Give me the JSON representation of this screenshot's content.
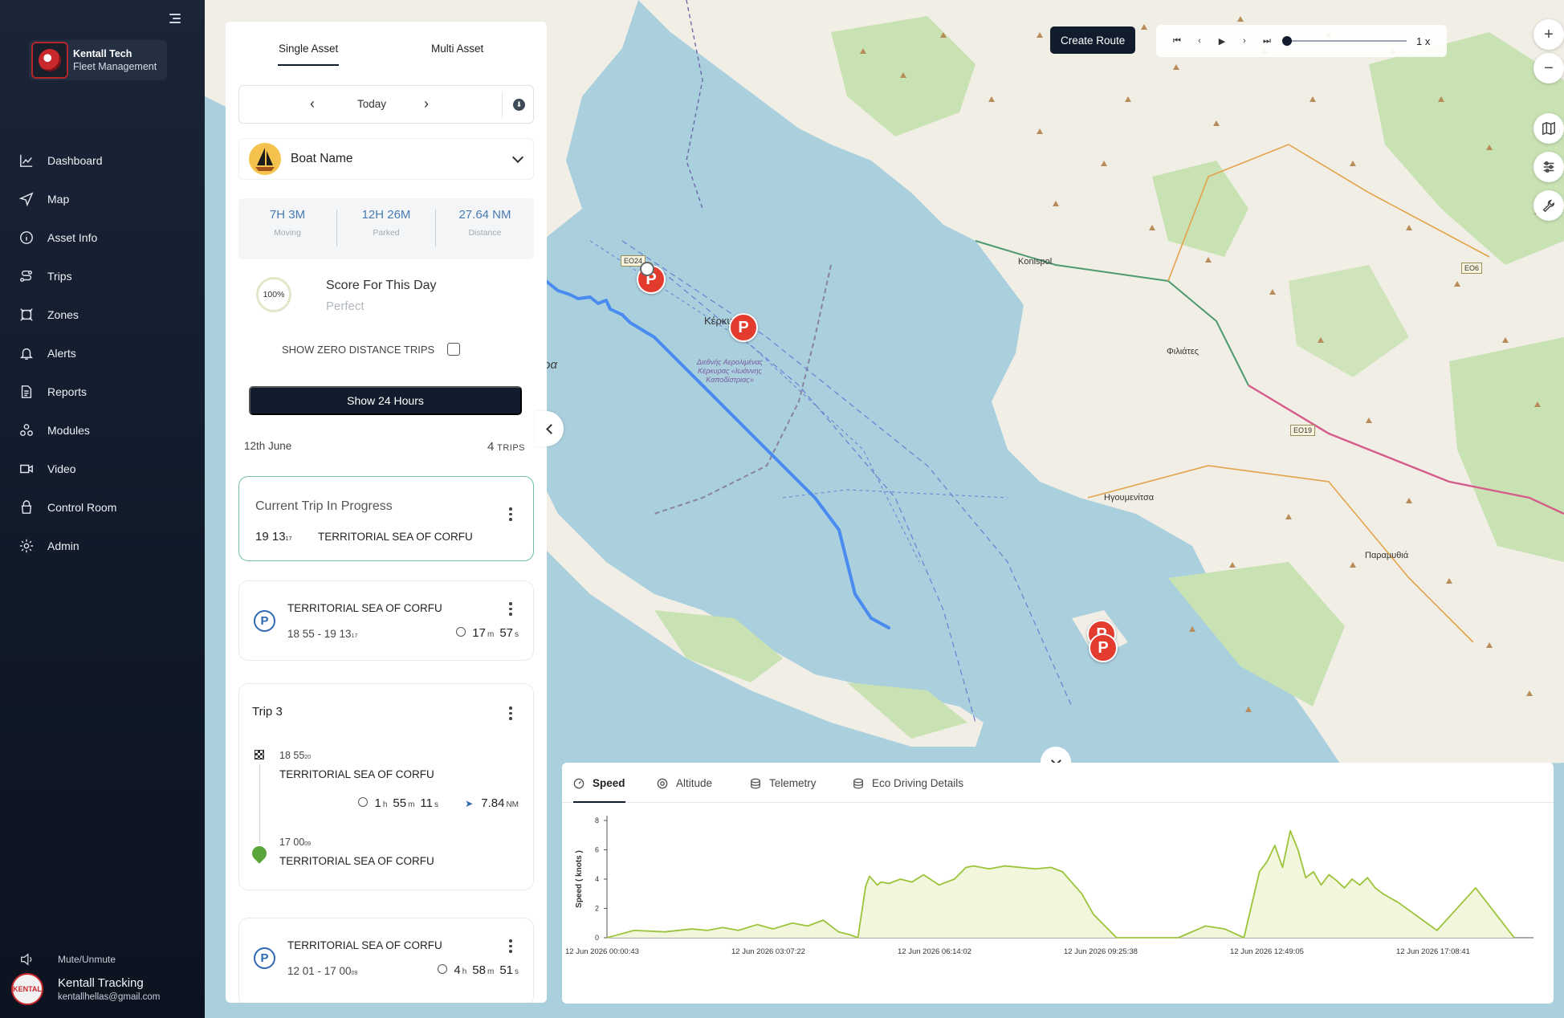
{
  "app": {
    "brand_name": "Kentall Tech",
    "brand_sub": "Fleet Management"
  },
  "sidebar": {
    "items": [
      {
        "label": "Dashboard",
        "icon": "chart-line-icon"
      },
      {
        "label": "Map",
        "icon": "navigation-icon"
      },
      {
        "label": "Asset Info",
        "icon": "info-icon"
      },
      {
        "label": "Trips",
        "icon": "route-icon"
      },
      {
        "label": "Zones",
        "icon": "zone-icon"
      },
      {
        "label": "Alerts",
        "icon": "bell-icon"
      },
      {
        "label": "Reports",
        "icon": "document-icon"
      },
      {
        "label": "Modules",
        "icon": "modules-icon"
      },
      {
        "label": "Video",
        "icon": "video-icon"
      },
      {
        "label": "Control Room",
        "icon": "control-room-icon"
      },
      {
        "label": "Admin",
        "icon": "gear-icon"
      }
    ],
    "mute_label": "Mute/Unmute",
    "user_name": "Kentall Tracking",
    "user_email": "kentallhellas@gmail.com",
    "avatar_text": "KENTAL"
  },
  "panel": {
    "tabs": [
      "Single Asset",
      "Multi Asset"
    ],
    "date_label": "Today",
    "asset_name": "Boat Name",
    "stats": [
      {
        "value": "7H 3M",
        "label": "Moving"
      },
      {
        "value": "12H 26M",
        "label": "Parked"
      },
      {
        "value": "27.64 NM",
        "label": "Distance"
      }
    ],
    "score_percent": "100%",
    "score_title": "Score For This Day",
    "score_sub": "Perfect",
    "zero_trips_label": "SHOW ZERO DISTANCE TRIPS",
    "show24_label": "Show 24 Hours",
    "day_label": "12th June",
    "trips_count": "4",
    "trips_word": "TRIPS",
    "current": {
      "title": "Current Trip In Progress",
      "time": "19 13",
      "time_sec": "17",
      "location": "TERRITORIAL SEA OF CORFU"
    },
    "park1": {
      "location": "TERRITORIAL SEA OF CORFU",
      "range": "18 55 - 19 13",
      "range_sec": "17",
      "dur": [
        "17",
        "m",
        "57",
        "s"
      ]
    },
    "trip3": {
      "title": "Trip 3",
      "end_time": "18 55",
      "end_sec": "20",
      "end_loc": "TERRITORIAL SEA OF CORFU",
      "dur": [
        "1",
        "h",
        "55",
        "m",
        "11",
        "s"
      ],
      "distance": "7.84",
      "distance_unit": "NM",
      "start_time": "17 00",
      "start_sec": "09",
      "start_loc": "TERRITORIAL SEA OF CORFU"
    },
    "park2": {
      "location": "TERRITORIAL SEA OF CORFU",
      "range": "12 01 - 17 00",
      "range_sec": "09",
      "dur": [
        "4",
        "h",
        "58",
        "m",
        "51",
        "s"
      ]
    }
  },
  "map": {
    "create_route": "Create Route",
    "playback_speed": "1 x",
    "pin_label": "P",
    "labels": {
      "kerkyra_big": "Κέρκυρα",
      "kerkyra_city": "Κέρκυ",
      "konispol": "Konispol",
      "filiates": "Φιλιάτες",
      "igoumenitsa": "Ηγουμενίτσα",
      "paramythia": "Παραμυθιά",
      "airport": "Διεθνής Αερολιμένας Κέρκυρας «Ιωάννης Καποδίστριας»",
      "road_eo24": "ΕΟ24",
      "road_e06": "ΕΟ6",
      "road_eo19": "ΕΟ19"
    }
  },
  "chart_tabs": [
    "Speed",
    "Altitude",
    "Telemetry",
    "Eco Driving Details"
  ],
  "chart_data": {
    "type": "area",
    "ylabel": "Speed ( knots )",
    "ylim": [
      0,
      8
    ],
    "yticks": [
      0,
      2,
      4,
      6,
      8
    ],
    "x_tick_labels": [
      "12 Jun 2026 00:00:43",
      "12 Jun 2026 03:07:22",
      "12 Jun 2026 06:14:02",
      "12 Jun 2026 09:25:38",
      "12 Jun 2026 12:49:05",
      "12 Jun 2026 17:08:41"
    ],
    "x_hours": [
      0,
      0.7,
      1.5,
      2.2,
      2.6,
      3.0,
      3.4,
      3.9,
      4.3,
      4.8,
      5.2,
      5.6,
      6.0,
      6.3,
      6.5,
      6.7,
      6.8,
      7.0,
      7.1,
      7.3,
      7.6,
      7.9,
      8.2,
      8.6,
      9.0,
      9.3,
      9.5,
      9.9,
      10.3,
      10.7,
      11.1,
      11.5,
      11.8,
      12.1,
      12.3,
      12.6,
      13.2,
      14.0,
      14.8,
      15.5,
      16.0,
      16.5,
      16.9,
      17.1,
      17.3,
      17.5,
      17.7,
      17.9,
      18.1,
      18.3,
      18.5,
      18.7,
      18.9,
      19.1,
      19.3,
      19.5,
      19.7,
      19.9,
      20.1,
      20.5,
      21.5,
      22.5,
      23.5
    ],
    "speed": [
      0,
      0.5,
      0.4,
      0.6,
      0.5,
      0.7,
      0.5,
      0.9,
      0.6,
      1.0,
      0.8,
      1.2,
      0.4,
      0.2,
      0,
      3.5,
      4.2,
      3.6,
      3.8,
      3.7,
      4.0,
      3.8,
      4.3,
      3.6,
      4.0,
      4.8,
      4.9,
      4.7,
      4.9,
      4.8,
      4.7,
      4.8,
      4.5,
      3.6,
      3.0,
      1.6,
      0,
      0,
      0,
      0.8,
      0.6,
      0,
      4.5,
      5.2,
      6.3,
      4.8,
      7.3,
      6.0,
      4.1,
      4.5,
      3.6,
      4.3,
      3.9,
      3.4,
      4.0,
      3.6,
      4.1,
      3.4,
      3.0,
      2.4,
      0.5,
      3.4,
      0
    ]
  }
}
